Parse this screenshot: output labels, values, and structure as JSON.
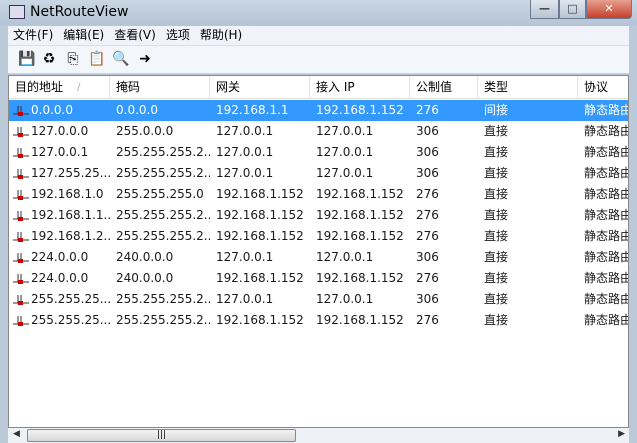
{
  "window": {
    "title": "NetRouteView",
    "min": "—",
    "max": "□",
    "close": "✕"
  },
  "menu": [
    "文件(F)",
    "编辑(E)",
    "查看(V)",
    "选项",
    "帮助(H)"
  ],
  "toolbar": [
    {
      "icon": "save-icon",
      "glyph": "💾"
    },
    {
      "icon": "refresh-icon",
      "glyph": "♻"
    },
    {
      "icon": "copy-icon",
      "glyph": "⎘"
    },
    {
      "icon": "properties-icon",
      "glyph": "📋"
    },
    {
      "icon": "find-icon",
      "glyph": "🔍"
    },
    {
      "icon": "exit-icon",
      "glyph": "➜"
    }
  ],
  "columns": [
    "目的地址",
    "掩码",
    "网关",
    "接入 IP",
    "公制值",
    "类型",
    "协议"
  ],
  "sort_indicator": "/",
  "rows": [
    [
      "0.0.0.0",
      "0.0.0.0",
      "192.168.1.1",
      "192.168.1.152",
      "276",
      "间接",
      "静态路由"
    ],
    [
      "127.0.0.0",
      "255.0.0.0",
      "127.0.0.1",
      "127.0.0.1",
      "306",
      "直接",
      "静态路由"
    ],
    [
      "127.0.0.1",
      "255.255.255.2...",
      "127.0.0.1",
      "127.0.0.1",
      "306",
      "直接",
      "静态路由"
    ],
    [
      "127.255.25...",
      "255.255.255.2...",
      "127.0.0.1",
      "127.0.0.1",
      "306",
      "直接",
      "静态路由"
    ],
    [
      "192.168.1.0",
      "255.255.255.0",
      "192.168.1.152",
      "192.168.1.152",
      "276",
      "直接",
      "静态路由"
    ],
    [
      "192.168.1.1...",
      "255.255.255.2...",
      "192.168.1.152",
      "192.168.1.152",
      "276",
      "直接",
      "静态路由"
    ],
    [
      "192.168.1.2...",
      "255.255.255.2...",
      "192.168.1.152",
      "192.168.1.152",
      "276",
      "直接",
      "静态路由"
    ],
    [
      "224.0.0.0",
      "240.0.0.0",
      "127.0.0.1",
      "127.0.0.1",
      "306",
      "直接",
      "静态路由"
    ],
    [
      "224.0.0.0",
      "240.0.0.0",
      "192.168.1.152",
      "192.168.1.152",
      "276",
      "直接",
      "静态路由"
    ],
    [
      "255.255.25...",
      "255.255.255.2...",
      "127.0.0.1",
      "127.0.0.1",
      "306",
      "直接",
      "静态路由"
    ],
    [
      "255.255.25...",
      "255.255.255.2...",
      "192.168.1.152",
      "192.168.1.152",
      "276",
      "直接",
      "静态路由"
    ]
  ],
  "scroll": {
    "left": "◀",
    "right": "▶",
    "grip": "|||"
  }
}
